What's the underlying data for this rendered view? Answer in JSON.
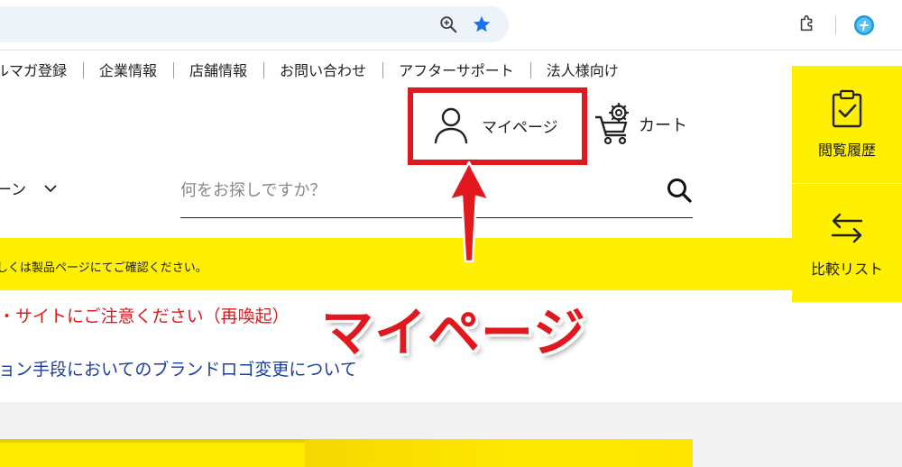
{
  "browser": {
    "zoom_icon": "zoom-in-icon",
    "bookmark_icon": "star-icon",
    "extensions_icon": "puzzle-icon",
    "profile_icon": "profile-avatar-icon",
    "accent_color": "#1a73e8"
  },
  "top_nav": {
    "items": [
      {
        "label": "ルマガ登録"
      },
      {
        "label": "企業情報"
      },
      {
        "label": "店舗情報"
      },
      {
        "label": "お問い合わせ"
      },
      {
        "label": "アフターサポート"
      },
      {
        "label": "法人様向け"
      }
    ]
  },
  "header": {
    "mypage_label": "マイページ",
    "cart_label": "カート",
    "category_label": "ーン"
  },
  "search": {
    "placeholder": "何をお探しですか？"
  },
  "rail": {
    "history_label": "閲覧履歴",
    "compare_label": "比較リスト",
    "bg_color": "#ffef00"
  },
  "notice": {
    "text": "しくは製品ページにてご確認ください。"
  },
  "news": {
    "item1": "・サイトにご注意ください（再喚起）",
    "item2": "ョン手段においてのブランドロゴ変更について"
  },
  "annotation": {
    "callout": "マイページ",
    "highlight_color": "#e1191f"
  }
}
